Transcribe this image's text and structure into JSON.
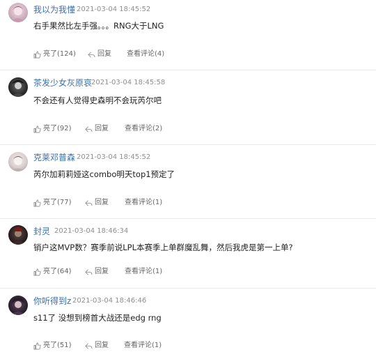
{
  "comments": [
    {
      "user": "我以为我懂",
      "time": "2021-03-04 18:45:52",
      "text": "右手果然比左手强。。。RNG大于LNG",
      "like": "亮了(124)",
      "reply": "回复",
      "view": "查看评论(4)",
      "avatar": "avatar-anime-girl"
    },
    {
      "user": "茶发少女灰原哀",
      "time": "2021-03-04 18:45:58",
      "text": "不会还有人觉得史森明不会玩芮尔吧",
      "like": "亮了(92)",
      "reply": "回复",
      "view": "查看评论(2)",
      "avatar": "avatar-dark-character"
    },
    {
      "user": "克莱邓普森",
      "time": "2021-03-04 18:45:52",
      "text": "芮尔加莉莉娅这combo明天top1预定了",
      "like": "亮了(77)",
      "reply": "回复",
      "view": "查看评论(1)",
      "avatar": "avatar-pale-face"
    },
    {
      "user": "封灵",
      "time": "2021-03-04 18:46:34",
      "text": "销户这MVP数？赛季前说LPL本赛季上单群魔乱舞，然后我虎是第一上单?",
      "like": "亮了(64)",
      "reply": "回复",
      "view": "查看评论(1)",
      "avatar": "avatar-dark-warrior"
    },
    {
      "user": "你听得到z",
      "time": "2021-03-04 18:46:46",
      "text": "s11了 没想到榜首大战还是edg rng",
      "like": "亮了(51)",
      "reply": "回复",
      "view": "查看评论(1)",
      "avatar": "avatar-dark-girl"
    }
  ]
}
